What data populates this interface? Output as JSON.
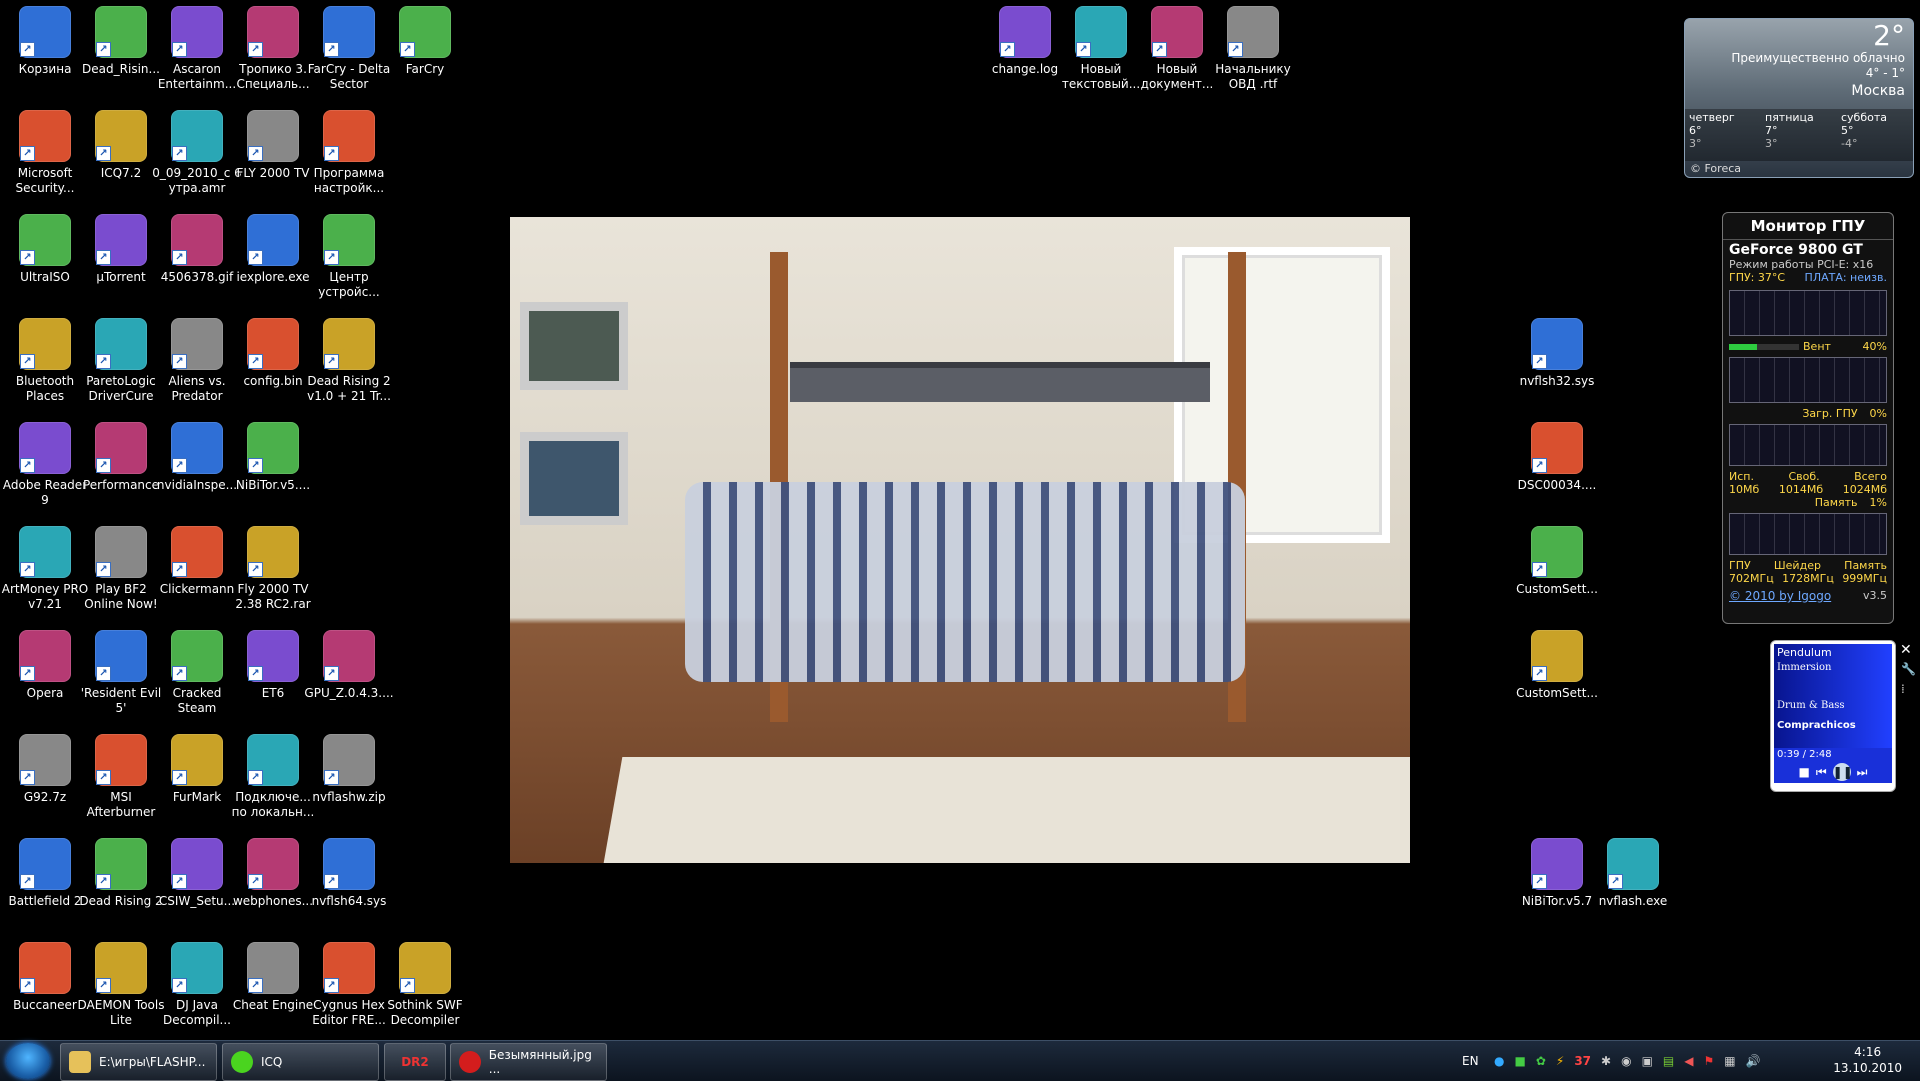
{
  "desktop": {
    "col1": [
      "Корзина",
      "Microsoft Security...",
      "UltraISO",
      "Bluetooth Places",
      "Adobe Reader 9",
      "ArtMoney PRO v7.21",
      "Opera",
      "G92.7z",
      "Battlefield 2",
      "Buccaneer"
    ],
    "col2": [
      "Dead_Risin...",
      "ICQ7.2",
      "µTorrent",
      "ParetoLogic DriverCure",
      "Performance",
      "Play BF2 Online Now!",
      "'Resident Evil 5'",
      "MSI Afterburner",
      "Dead Rising 2",
      "DAEMON Tools Lite"
    ],
    "col3": [
      "Ascaron Entertainm...",
      "0_09_2010_c 6 утра.amr",
      "4506378.gif",
      "Aliens vs. Predator",
      "nvidiaInspe...",
      "Clickermann",
      "Cracked Steam",
      "FurMark",
      "CSIW_Setu...",
      "DJ Java Decompil..."
    ],
    "col4": [
      "Тропико 3. Специаль...",
      "FLY 2000 TV",
      "iexplore.exe",
      "config.bin",
      "NiBiTor.v5....",
      "Fly 2000 TV 2.38 RC2.rar",
      "ET6",
      "Подключе... по локальн...",
      "webphones...",
      "Cheat Engine"
    ],
    "col5": [
      "FarCry - Delta Sector",
      "Программа настройк...",
      "Центр устройс...",
      "Dead Rising 2 v1.0 + 21 Tr...",
      "",
      "",
      "GPU_Z.0.4.3....",
      "nvflashw.zip",
      "nvflsh64.sys",
      "Cygnus Hex Editor FRE..."
    ],
    "col6": [
      "FarCry",
      "",
      "",
      "",
      "",
      "",
      "",
      "",
      "",
      "Sothink SWF Decompiler"
    ],
    "top": [
      "change.log",
      "Новый текстовый...",
      "Новый документ...",
      "Начальнику ОВД .rtf"
    ],
    "right": [
      "nvflsh32.sys",
      "DSC00034....",
      "CustomSett...",
      "CustomSett...",
      "NiBiTor.v5.7"
    ],
    "right2": [
      "nvflash.exe"
    ]
  },
  "weather": {
    "temp": "2°",
    "condition": "Преимущественно облачно",
    "range": "4° - 1°",
    "city": "Москва",
    "days": [
      {
        "name": "четверг",
        "hi": "6°",
        "lo": "3°"
      },
      {
        "name": "пятница",
        "hi": "7°",
        "lo": "3°"
      },
      {
        "name": "суббота",
        "hi": "5°",
        "lo": "-4°"
      }
    ],
    "source": "© Foreca"
  },
  "gpu": {
    "title": "Монитор ГПУ",
    "card": "GeForce 9800 GT",
    "mode": "Режим работы PCI-E: x16",
    "temp_label": "ГПУ: 37°C",
    "board_label": "ПЛАТА: неизв.",
    "fan_label": "Вент",
    "fan_value": "40%",
    "fan_level": 0.4,
    "load_label": "Загр. ГПУ",
    "load_value": "0%",
    "mem_headers": [
      "Исп.",
      "Своб.",
      "Всего"
    ],
    "mem_values": [
      "10Мб",
      "1014Мб",
      "1024Мб"
    ],
    "mem_label": "Память",
    "mem_value": "1%",
    "clock_headers": [
      "ГПУ",
      "Шейдер",
      "Память"
    ],
    "clock_values": [
      "702МГц",
      "1728МГц",
      "999МГц"
    ],
    "copyright": "© 2010 by Igogo",
    "version": "v3.5"
  },
  "player": {
    "artist": "Pendulum",
    "album": "Immersion",
    "genre": "Drum & Bass",
    "track": "Comprachicos",
    "time": "0:39 / 2:48"
  },
  "taskbar": {
    "tasks": [
      "E:\\игры\\FLASHP...",
      "ICQ",
      "DR2",
      "Безымянный.jpg ..."
    ],
    "lang": "EN",
    "tray_badge": "37",
    "time": "4:16",
    "date": "13.10.2010"
  },
  "colors": {
    "desktop": "#000000",
    "accent": "#2a8bff",
    "gpu_header": "#ffffff",
    "gpu_yellow": "#ffd84a",
    "gpu_blue": "#6ea8ff",
    "player_bg": "#1930d9"
  }
}
